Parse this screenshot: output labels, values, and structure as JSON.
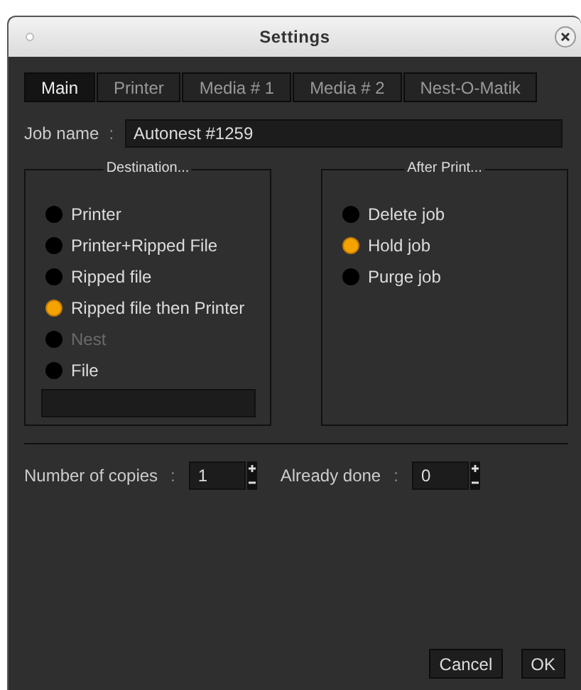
{
  "window": {
    "title": "Settings"
  },
  "tabs": [
    {
      "label": "Main",
      "selected": true
    },
    {
      "label": "Printer",
      "selected": false
    },
    {
      "label": "Media # 1",
      "selected": false
    },
    {
      "label": "Media # 2",
      "selected": false
    },
    {
      "label": "Nest-O-Matik",
      "selected": false
    }
  ],
  "job_name": {
    "label": "Job name",
    "separator": ":",
    "value": "Autonest #1259"
  },
  "destination": {
    "title": "Destination...",
    "options": [
      {
        "label": "Printer",
        "selected": false,
        "disabled": false
      },
      {
        "label": "Printer+Ripped File",
        "selected": false,
        "disabled": false
      },
      {
        "label": "Ripped file",
        "selected": false,
        "disabled": false
      },
      {
        "label": "Ripped file then Printer",
        "selected": true,
        "disabled": false
      },
      {
        "label": "Nest",
        "selected": false,
        "disabled": true
      },
      {
        "label": "File",
        "selected": false,
        "disabled": false
      }
    ]
  },
  "after_print": {
    "title": "After Print...",
    "options": [
      {
        "label": "Delete job",
        "selected": false
      },
      {
        "label": "Hold job",
        "selected": true
      },
      {
        "label": "Purge job",
        "selected": false
      }
    ]
  },
  "copies": {
    "label": "Number of copies",
    "separator": ":",
    "value": "1"
  },
  "already_done": {
    "label": "Already done",
    "separator": ":",
    "value": "0"
  },
  "buttons": [
    "Cancel",
    "OK"
  ]
}
